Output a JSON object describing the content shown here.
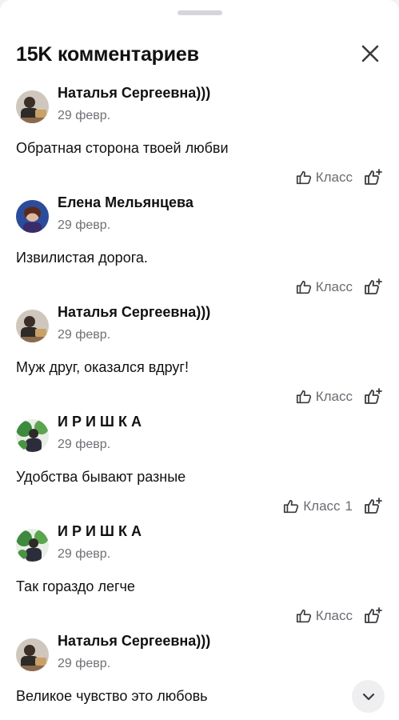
{
  "header": {
    "title": "15K комментариев",
    "close_icon": "close-icon"
  },
  "like_label": "Класс",
  "comments": [
    {
      "author": "Наталья Сергеевна)))",
      "date": "29 февр.",
      "text": "Обратная сторона твоей любви",
      "likes": ""
    },
    {
      "author": "Елена Мельянцева",
      "date": "29 февр.",
      "text": "Извилистая дорога.",
      "likes": ""
    },
    {
      "author": "Наталья Сергеевна)))",
      "date": "29 февр.",
      "text": "Муж друг, оказался вдруг!",
      "likes": ""
    },
    {
      "author": "И Р И Ш К А",
      "date": "29 февр.",
      "text": "Удобства бывают разные",
      "likes": "1"
    },
    {
      "author": "И Р И Ш К А",
      "date": "29 февр.",
      "text": "Так гораздо легче",
      "likes": ""
    },
    {
      "author": "Наталья Сергеевна)))",
      "date": "29 февр.",
      "text": "Великое чувство это любовь",
      "likes": ""
    }
  ],
  "icons": {
    "like": "thumbs-up-icon",
    "react": "thumbs-up-plus-icon",
    "scroll": "chevron-down-icon"
  },
  "colors": {
    "text": "#111111",
    "secondary": "#6f6f75",
    "background": "#ffffff"
  }
}
